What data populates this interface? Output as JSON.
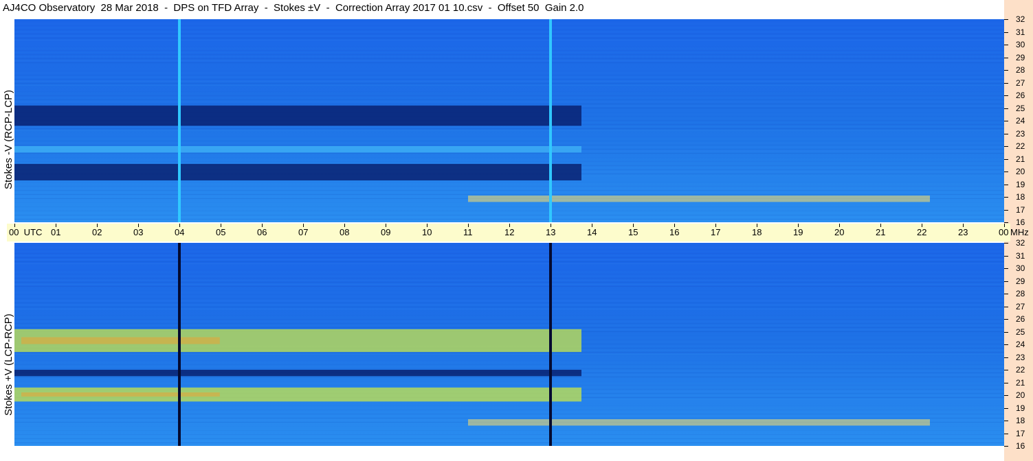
{
  "title": "AJ4CO Observatory  28 Mar 2018  -  DPS on TFD Array  -  Stokes ±V  -  Correction Array 2017 01 10.csv  -  Offset 50  Gain 2.0",
  "colors": {
    "side_strip": "#fde0c8",
    "time_strip": "#fdfccc",
    "spectrogram_base": "#1e6ee6"
  },
  "chart_data": [
    {
      "type": "heatmap",
      "ylabel": "Stokes -V (RCP-LCP)",
      "y_unit": "MHz",
      "ylim": [
        16,
        32
      ],
      "y_ticks": [
        "32",
        "31",
        "30",
        "29",
        "28",
        "27",
        "26",
        "25",
        "24",
        "23",
        "22",
        "21",
        "20",
        "19",
        "18",
        "17",
        "16"
      ],
      "x_ticks": [
        "00  UTC",
        "01",
        "02",
        "03",
        "04",
        "05",
        "06",
        "07",
        "08",
        "09",
        "10",
        "11",
        "12",
        "13",
        "14",
        "15",
        "16",
        "17",
        "18",
        "19",
        "20",
        "21",
        "22",
        "23",
        "00"
      ],
      "xlim_hours_utc": [
        0,
        24
      ],
      "vertical_markers_hours_utc": [
        4.0,
        13.0
      ],
      "features": [
        {
          "name": "dark band",
          "freq_mhz": [
            23.6,
            25.2
          ],
          "hours_utc": [
            0,
            13.75
          ]
        },
        {
          "name": "dark band",
          "freq_mhz": [
            19.3,
            20.6
          ],
          "hours_utc": [
            0,
            13.75
          ]
        },
        {
          "name": "bright band",
          "freq_mhz": [
            21.5,
            22.0
          ],
          "hours_utc": [
            0,
            13.75
          ]
        },
        {
          "name": "interference",
          "freq_mhz": [
            17.6,
            18.1
          ],
          "hours_utc": [
            11,
            22.2
          ]
        }
      ]
    },
    {
      "type": "heatmap",
      "ylabel": "Stokes +V (LCP-RCP)",
      "y_unit": "MHz",
      "ylim": [
        16,
        32
      ],
      "y_ticks": [
        "32",
        "31",
        "30",
        "29",
        "28",
        "27",
        "26",
        "25",
        "24",
        "23",
        "22",
        "21",
        "20",
        "19",
        "18",
        "17",
        "16"
      ],
      "x_ticks": [
        "00  UTC",
        "01",
        "02",
        "03",
        "04",
        "05",
        "06",
        "07",
        "08",
        "09",
        "10",
        "11",
        "12",
        "13",
        "14",
        "15",
        "16",
        "17",
        "18",
        "19",
        "20",
        "21",
        "22",
        "23",
        "00"
      ],
      "xlim_hours_utc": [
        0,
        24
      ],
      "vertical_markers_hours_utc": [
        4.0,
        13.0
      ],
      "features": [
        {
          "name": "bright band",
          "freq_mhz": [
            23.4,
            25.2
          ],
          "hours_utc": [
            0,
            13.75
          ]
        },
        {
          "name": "bright band",
          "freq_mhz": [
            19.5,
            20.6
          ],
          "hours_utc": [
            0,
            13.75
          ]
        },
        {
          "name": "dark band",
          "freq_mhz": [
            21.5,
            22.0
          ],
          "hours_utc": [
            0,
            13.75
          ]
        },
        {
          "name": "interference",
          "freq_mhz": [
            17.6,
            18.1
          ],
          "hours_utc": [
            11,
            22.2
          ]
        }
      ]
    }
  ],
  "x_unit_label": "MHz"
}
